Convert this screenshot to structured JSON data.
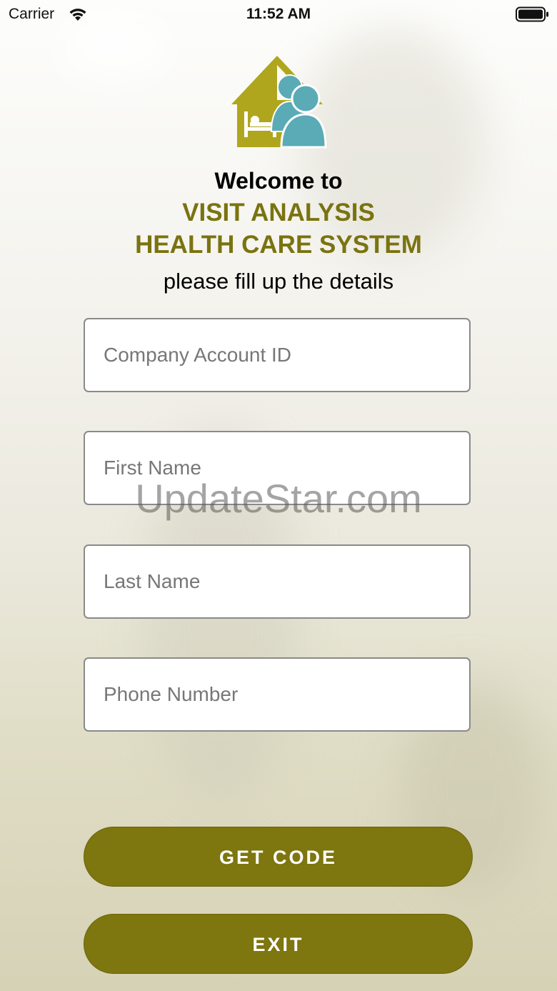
{
  "status_bar": {
    "carrier": "Carrier",
    "time": "11:52 AM",
    "wifi_icon": "wifi-icon",
    "battery_icon": "battery-icon"
  },
  "logo": {
    "icon": "hospital-visit-logo",
    "colors": {
      "house": "#b0a61d",
      "people": "#5aabb6"
    }
  },
  "header": {
    "welcome": "Welcome to",
    "title_line1": "VISIT ANALYSIS",
    "title_line2": "HEALTH CARE SYSTEM",
    "subtitle": "please fill up the details"
  },
  "form": {
    "company_account_id": {
      "value": "",
      "placeholder": "Company Account ID"
    },
    "first_name": {
      "value": "",
      "placeholder": "First Name"
    },
    "last_name": {
      "value": "",
      "placeholder": "Last Name"
    },
    "phone_number": {
      "value": "",
      "placeholder": "Phone Number"
    }
  },
  "buttons": {
    "get_code": "GET CODE",
    "exit": "EXIT"
  },
  "watermark": "UpdateStar.com",
  "colors": {
    "accent": "#7a7310",
    "button_bg": "#7e760e",
    "button_text": "#ffffff"
  }
}
